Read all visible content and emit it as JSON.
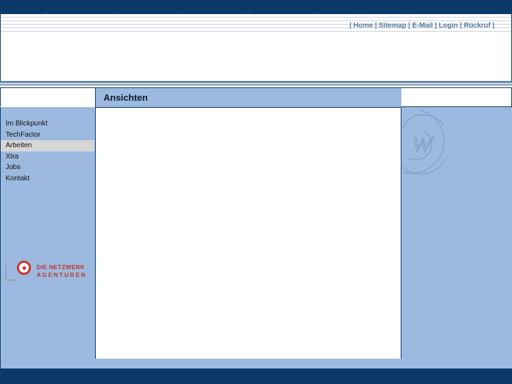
{
  "top_nav": {
    "prefix": "|",
    "items": [
      {
        "label": "Home"
      },
      {
        "label": "Sitemap"
      },
      {
        "label": "E-Mail"
      },
      {
        "label": "Login"
      },
      {
        "label": "Rückruf"
      }
    ],
    "separator": "|"
  },
  "page": {
    "title": "Ansichten"
  },
  "sidebar": {
    "items": [
      {
        "label": "Im Blickpunkt",
        "active": false
      },
      {
        "label": "TechFactor",
        "active": false
      },
      {
        "label": "Arbeiten",
        "active": true
      },
      {
        "label": "Xtra",
        "active": false
      },
      {
        "label": "Jobs",
        "active": false
      },
      {
        "label": "Kontakt",
        "active": false
      }
    ]
  },
  "logo": {
    "line1": "DIE NETZWERK",
    "line2": "AGENTUREN"
  },
  "colors": {
    "navy": "#0b3a6a",
    "light_blue": "#9cbadf",
    "active_item": "#d6d6d6",
    "logo_red": "#d0312d"
  }
}
